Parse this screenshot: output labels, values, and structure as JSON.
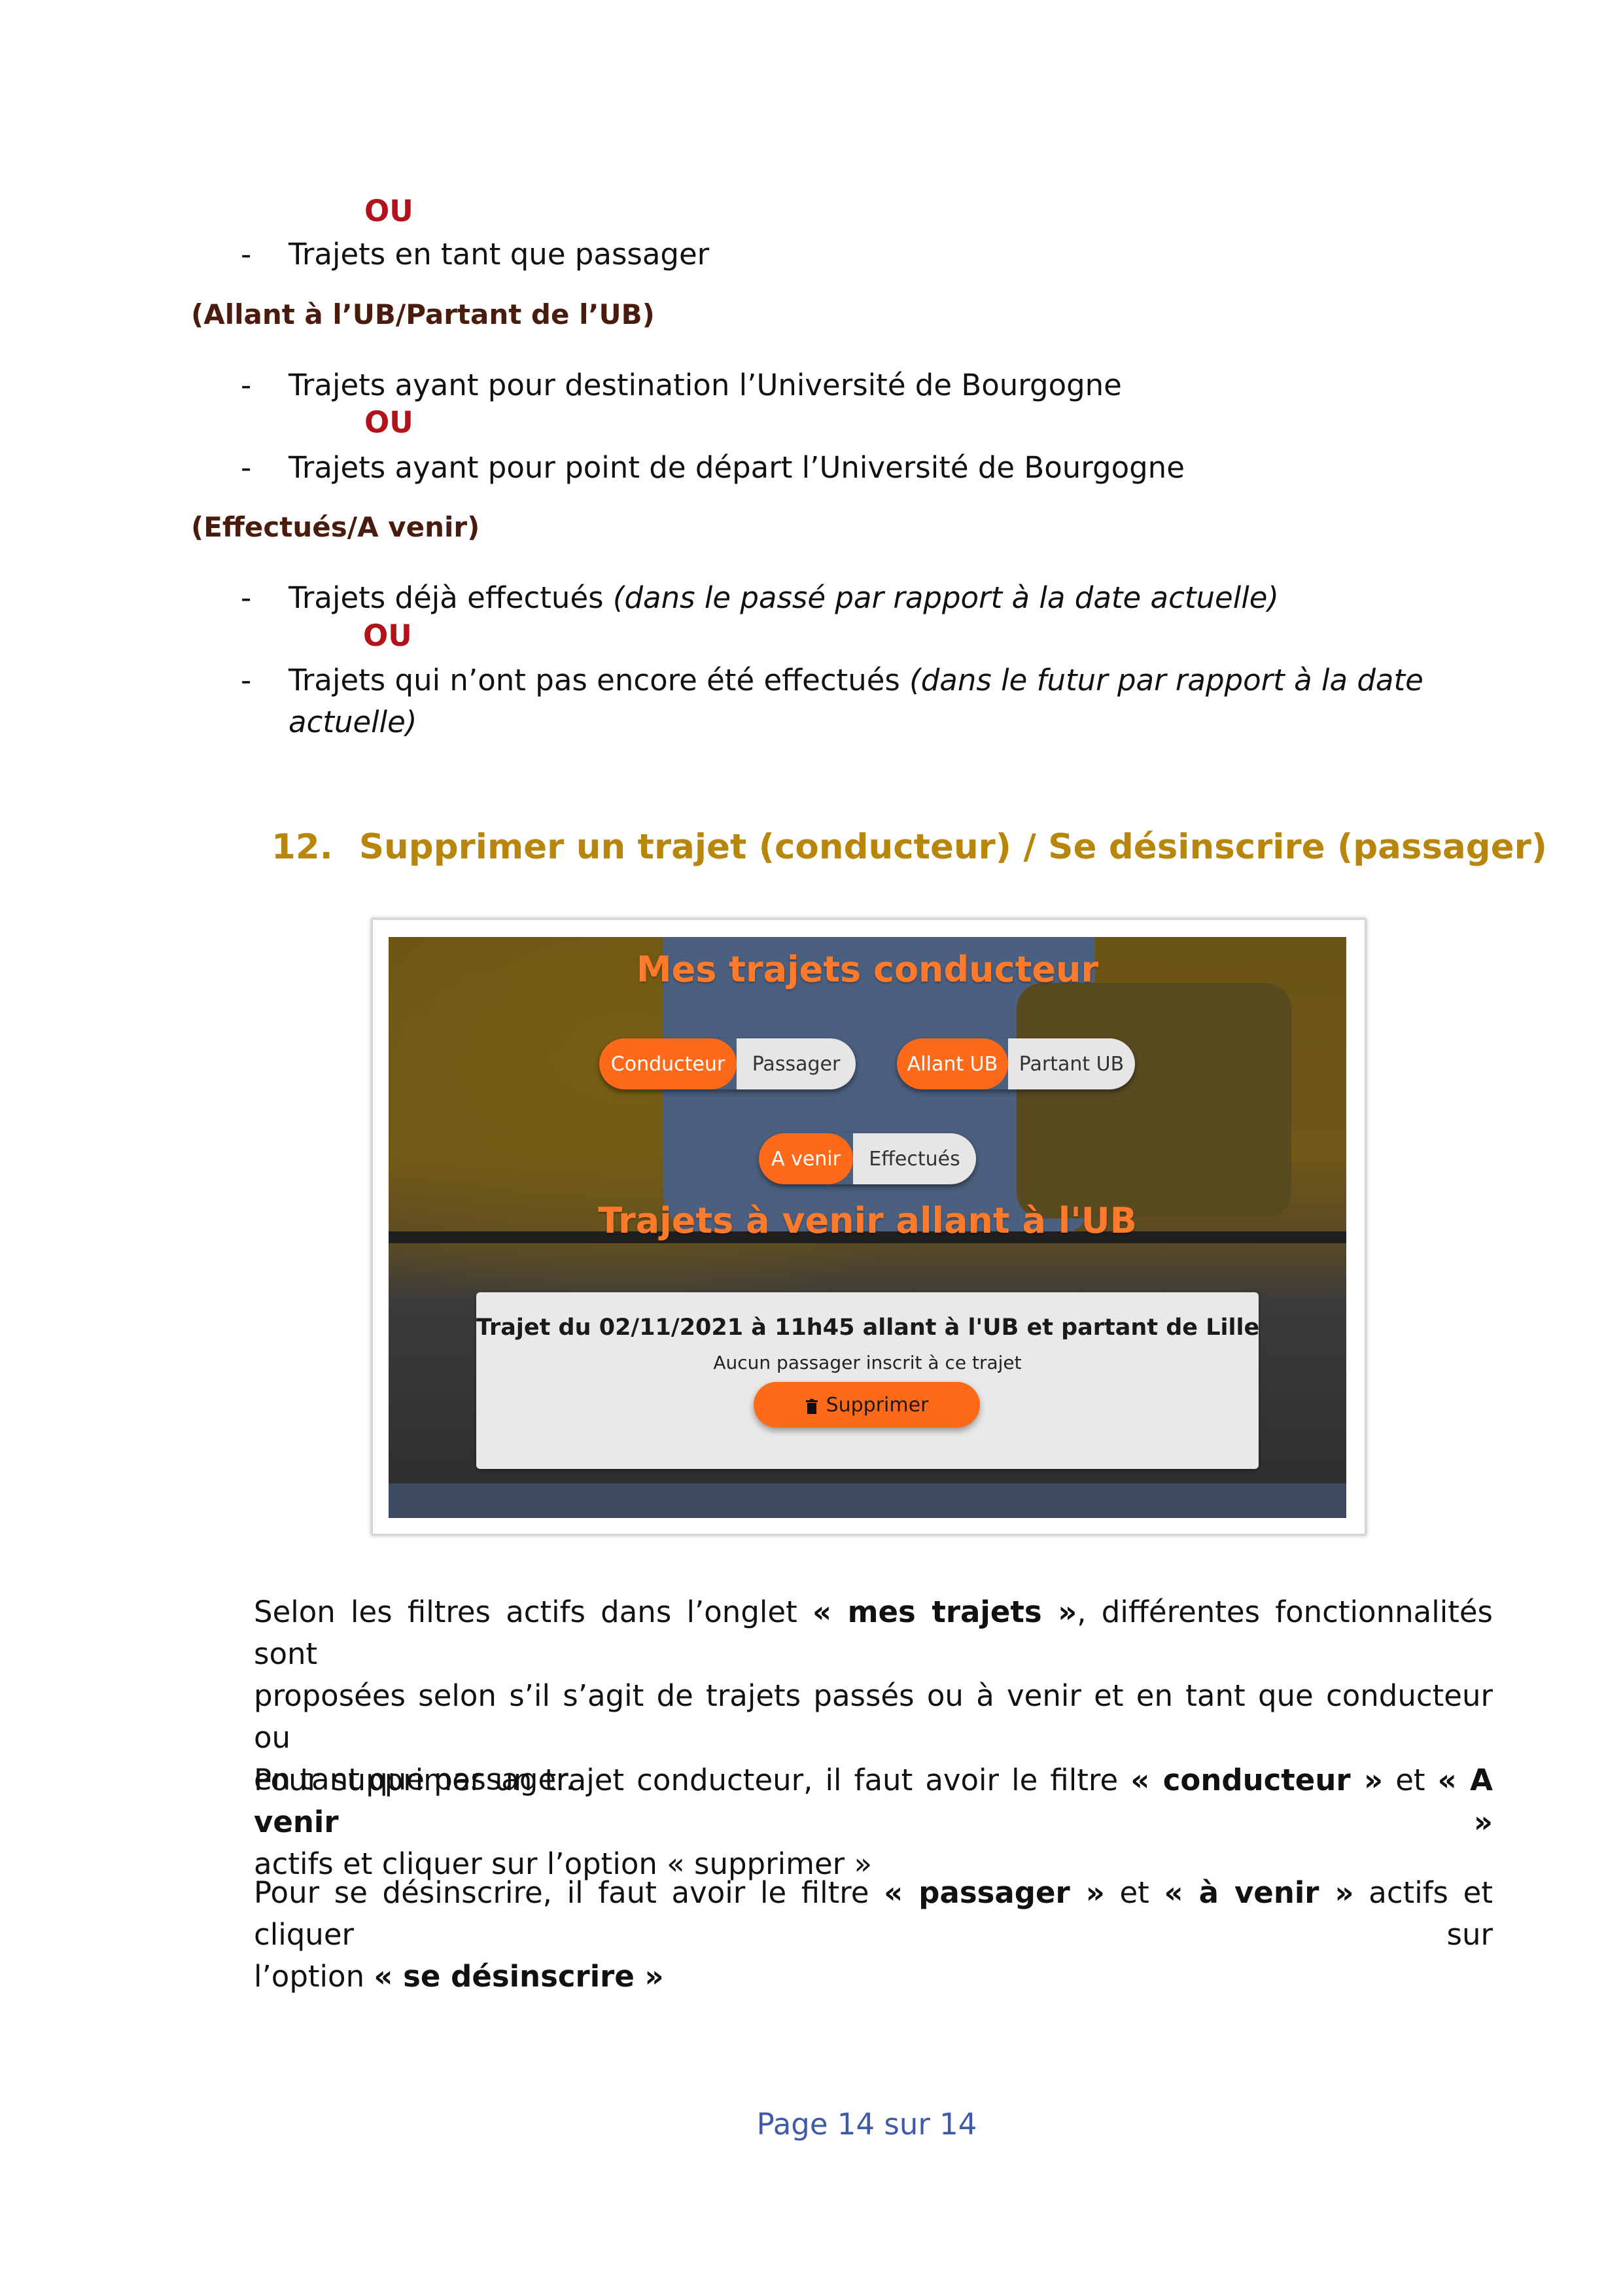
{
  "top": {
    "ou1": "OU",
    "item_passager": "Trajets en tant que passager"
  },
  "filter_ub": {
    "heading": "(Allant à l’UB/Partant de l’UB)",
    "item1": "Trajets ayant pour destination l’Université de Bourgogne",
    "ou": "OU",
    "item2": "Trajets ayant pour point de départ l’Université de Bourgogne"
  },
  "filter_time": {
    "heading": "(Effectués/A venir)",
    "item1_text": "Trajets déjà effectués ",
    "item1_note": "(dans le passé par rapport à la date actuelle)",
    "ou": "OU",
    "item2_text": "Trajets qui n’ont pas encore été effectués ",
    "item2_note_line1": "(dans le futur par rapport à la date",
    "item2_note_line2": "actuelle)"
  },
  "section": {
    "number": "12.",
    "title": "Supprimer un trajet (conducteur) / Se désinscrire (passager)"
  },
  "screenshot": {
    "title": "Mes trajets conducteur",
    "toggle_role": {
      "on": "Conducteur",
      "off": "Passager"
    },
    "toggle_direction": {
      "on": "Allant UB",
      "off": "Partant UB"
    },
    "toggle_time": {
      "on": "A venir",
      "off": "Effectués"
    },
    "list_title": "Trajets à venir allant à l'UB",
    "card": {
      "title": "Trajet du 02/11/2021 à 11h45 allant à l'UB et partant de Lille",
      "subtitle": "Aucun passager inscrit à ce trajet",
      "button": "Supprimer",
      "button_icon": "trash-icon"
    },
    "colors": {
      "accent": "#ff6a1a",
      "title": "#ff7a2a"
    }
  },
  "paragraphs": {
    "p1_l1_a": "Selon les filtres actifs dans l’onglet ",
    "p1_l1_b": "« mes trajets »",
    "p1_l1_c": ", différentes fonctionnalités sont",
    "p1_l2": "proposées selon s’il s’agit de trajets passés ou à venir et en tant que conducteur ou",
    "p1_l3": "en tant que passager.",
    "p2_l1_a": "Pour supprimer un trajet conducteur, il faut avoir le filtre ",
    "p2_l1_b": "« conducteur »",
    "p2_l1_c": " et ",
    "p2_l1_d": "« A venir »",
    "p2_l2": "actifs et cliquer sur l’option « supprimer »",
    "p3_l1_a": "Pour se désinscrire, il faut avoir le filtre ",
    "p3_l1_b": "« passager »",
    "p3_l1_c": " et ",
    "p3_l1_d": "« à venir »",
    "p3_l1_e": " actifs et cliquer sur",
    "p3_l2_a": "l’option ",
    "p3_l2_b": "« se désinscrire »"
  },
  "footer": {
    "page": "Page 14 sur 14"
  }
}
